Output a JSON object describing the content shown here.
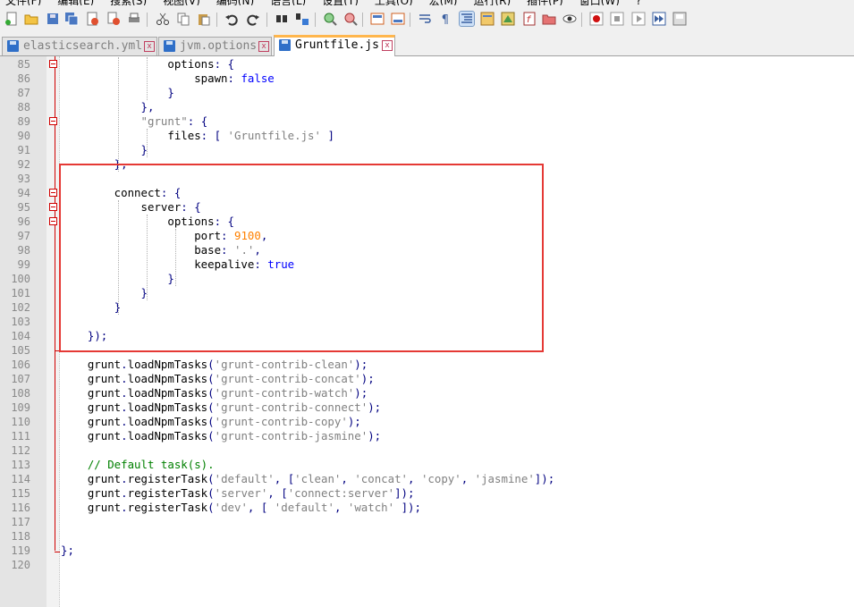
{
  "menu": [
    "文件(F)",
    "编辑(E)",
    "搜索(S)",
    "视图(V)",
    "编码(N)",
    "语言(L)",
    "设置(T)",
    "工具(O)",
    "宏(M)",
    "运行(R)",
    "插件(P)",
    "窗口(W)",
    "?"
  ],
  "toolbar": {
    "icons": [
      "new-file-icon",
      "open-file-icon",
      "save-icon",
      "save-all-icon",
      "close-icon",
      "close-all-icon",
      "print-icon",
      "cut-icon",
      "copy-icon",
      "paste-icon",
      "undo-icon",
      "redo-icon",
      "find-icon",
      "replace-icon",
      "zoom-in-icon",
      "zoom-out-icon",
      "sync-vertical-icon",
      "sync-horizontal-icon",
      "word-wrap-icon",
      "show-all-chars-icon",
      "indent-guide-icon",
      "language-icon",
      "doc-map-icon",
      "function-list-icon",
      "folder-workspace-icon",
      "monitor-icon",
      "record-macro-icon",
      "stop-record-icon",
      "play-macro-icon",
      "run-multiple-macro-icon",
      "save-macro-icon"
    ]
  },
  "tabs": [
    {
      "label": "elasticsearch.yml",
      "active": false
    },
    {
      "label": "jvm.options",
      "active": false
    },
    {
      "label": "Gruntfile.js",
      "active": true
    }
  ],
  "colors": {
    "highlight": "#e53935",
    "fold": "#d00000",
    "keyword": "#000080",
    "string": "#808080",
    "number": "#ff8000",
    "boolean": "#0000ff",
    "comment": "#008000",
    "active_tab": "#ffb64c"
  },
  "editor": {
    "lines": [
      {
        "n": "85",
        "t": "                options: {"
      },
      {
        "n": "86",
        "t": "                    spawn: false"
      },
      {
        "n": "87",
        "t": "                }"
      },
      {
        "n": "88",
        "t": "            },"
      },
      {
        "n": "89",
        "t": "            \"grunt\": {"
      },
      {
        "n": "90",
        "t": "                files: [ 'Gruntfile.js' ]"
      },
      {
        "n": "91",
        "t": "            }"
      },
      {
        "n": "92",
        "t": "        },"
      },
      {
        "n": "93",
        "t": ""
      },
      {
        "n": "94",
        "t": "        connect: {"
      },
      {
        "n": "95",
        "t": "            server: {"
      },
      {
        "n": "96",
        "t": "                options: {"
      },
      {
        "n": "97",
        "t": "                    port: 9100,"
      },
      {
        "n": "98",
        "t": "                    base: '.',"
      },
      {
        "n": "99",
        "t": "                    keepalive: true"
      },
      {
        "n": "100",
        "t": "                }"
      },
      {
        "n": "101",
        "t": "            }"
      },
      {
        "n": "102",
        "t": "        }"
      },
      {
        "n": "103",
        "t": ""
      },
      {
        "n": "104",
        "t": "    });"
      },
      {
        "n": "105",
        "t": ""
      },
      {
        "n": "106",
        "t": "    grunt.loadNpmTasks('grunt-contrib-clean');"
      },
      {
        "n": "107",
        "t": "    grunt.loadNpmTasks('grunt-contrib-concat');"
      },
      {
        "n": "108",
        "t": "    grunt.loadNpmTasks('grunt-contrib-watch');"
      },
      {
        "n": "109",
        "t": "    grunt.loadNpmTasks('grunt-contrib-connect');"
      },
      {
        "n": "110",
        "t": "    grunt.loadNpmTasks('grunt-contrib-copy');"
      },
      {
        "n": "111",
        "t": "    grunt.loadNpmTasks('grunt-contrib-jasmine');"
      },
      {
        "n": "112",
        "t": ""
      },
      {
        "n": "113",
        "t": "    // Default task(s)."
      },
      {
        "n": "114",
        "t": "    grunt.registerTask('default', ['clean', 'concat', 'copy', 'jasmine']);"
      },
      {
        "n": "115",
        "t": "    grunt.registerTask('server', ['connect:server']);"
      },
      {
        "n": "116",
        "t": "    grunt.registerTask('dev', [ 'default', 'watch' ]);"
      },
      {
        "n": "117",
        "t": ""
      },
      {
        "n": "118",
        "t": ""
      },
      {
        "n": "119",
        "t": "};"
      },
      {
        "n": "120",
        "t": ""
      }
    ]
  }
}
